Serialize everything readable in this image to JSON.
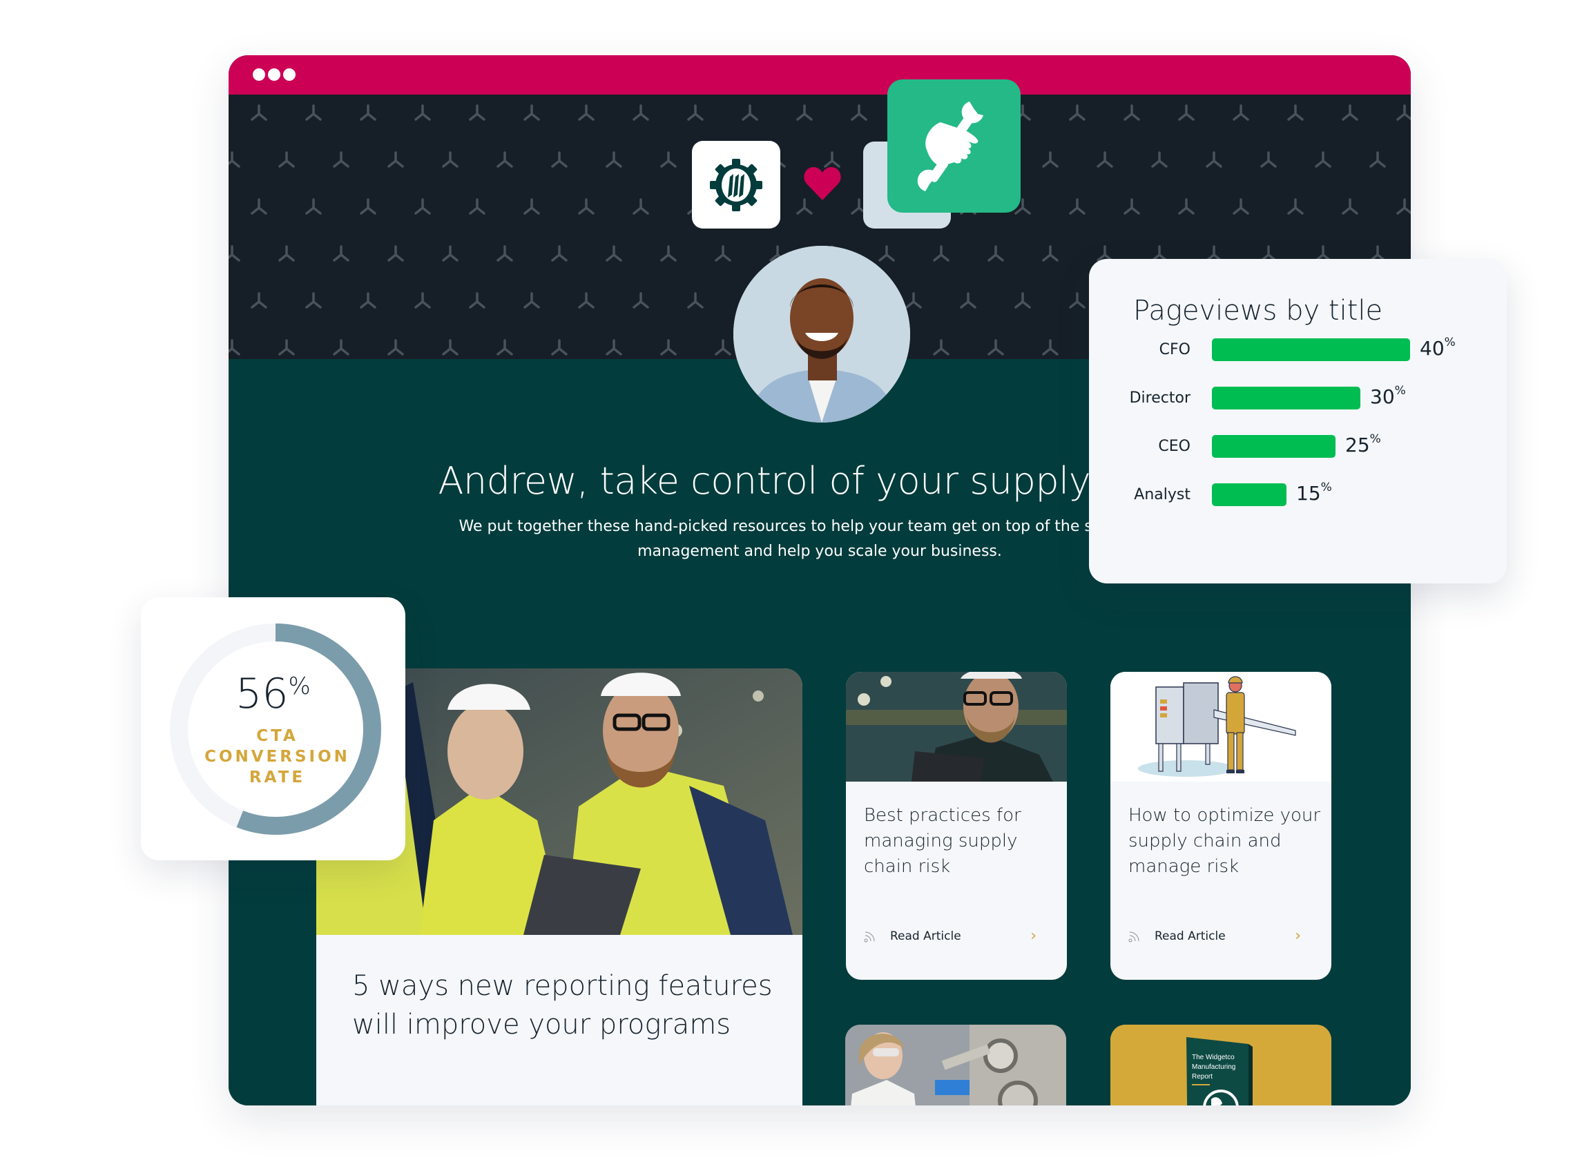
{
  "window": {
    "controls": [
      "window-dot",
      "window-dot",
      "window-dot"
    ],
    "accent_color": "#CC0055",
    "banner_color": "#161F27",
    "body_color": "#033C3C"
  },
  "brand": {
    "logo_icon": "gear-logo-icon",
    "heart_icon": "heart-icon",
    "partner_icon": "hand-wrench-icon",
    "partner_color": "#24B987",
    "heart_color": "#CC0055"
  },
  "hero": {
    "avatar": "avatar-photo",
    "headline": "Andrew, take control of your supply chain",
    "subtext": "We put together these hand-picked resources to help your team get on top of the supply chain management and help you scale your business."
  },
  "featured": {
    "title": "5 ways new reporting features will improve your programs",
    "image": "workers-with-laptop-photo"
  },
  "articles": [
    {
      "title": "Best practices for managing supply chain risk",
      "image": "engineer-with-tablet-photo",
      "action_label": "Read Article",
      "icon": "rss-icon",
      "chevron": "chevron-right-icon"
    },
    {
      "title": "How to optimize your supply chain and manage risk",
      "image": "conveyor-worker-illustration",
      "action_label": "Read Article",
      "icon": "rss-icon",
      "chevron": "chevron-right-icon"
    }
  ],
  "bottom_cards": [
    {
      "image": "scientist-lab-photo"
    },
    {
      "image": "report-book-cover",
      "book_title": "The Widgetco Manufacturing Report",
      "color": "#D4A93A"
    }
  ],
  "chart_data": [
    {
      "type": "bar",
      "orientation": "horizontal",
      "title": "Pageviews by title",
      "categories": [
        "CFO",
        "Director",
        "CEO",
        "Analyst"
      ],
      "values": [
        40,
        30,
        25,
        15
      ],
      "value_labels": [
        "40",
        "30",
        "25",
        "15"
      ],
      "unit": "%",
      "color": "#00BD52",
      "xlim": [
        0,
        40
      ],
      "grid": false,
      "legend": "none"
    },
    {
      "type": "pie",
      "variant": "donut-gauge",
      "title": "CTA CONVERSION RATE",
      "label_lines": [
        "CTA",
        "CONVERSION",
        "RATE"
      ],
      "value": 56,
      "value_label": "56",
      "unit": "%",
      "fill_color": "#7B9CAB",
      "track_color": "#F3F5F9",
      "label_color": "#D4A63A"
    }
  ]
}
